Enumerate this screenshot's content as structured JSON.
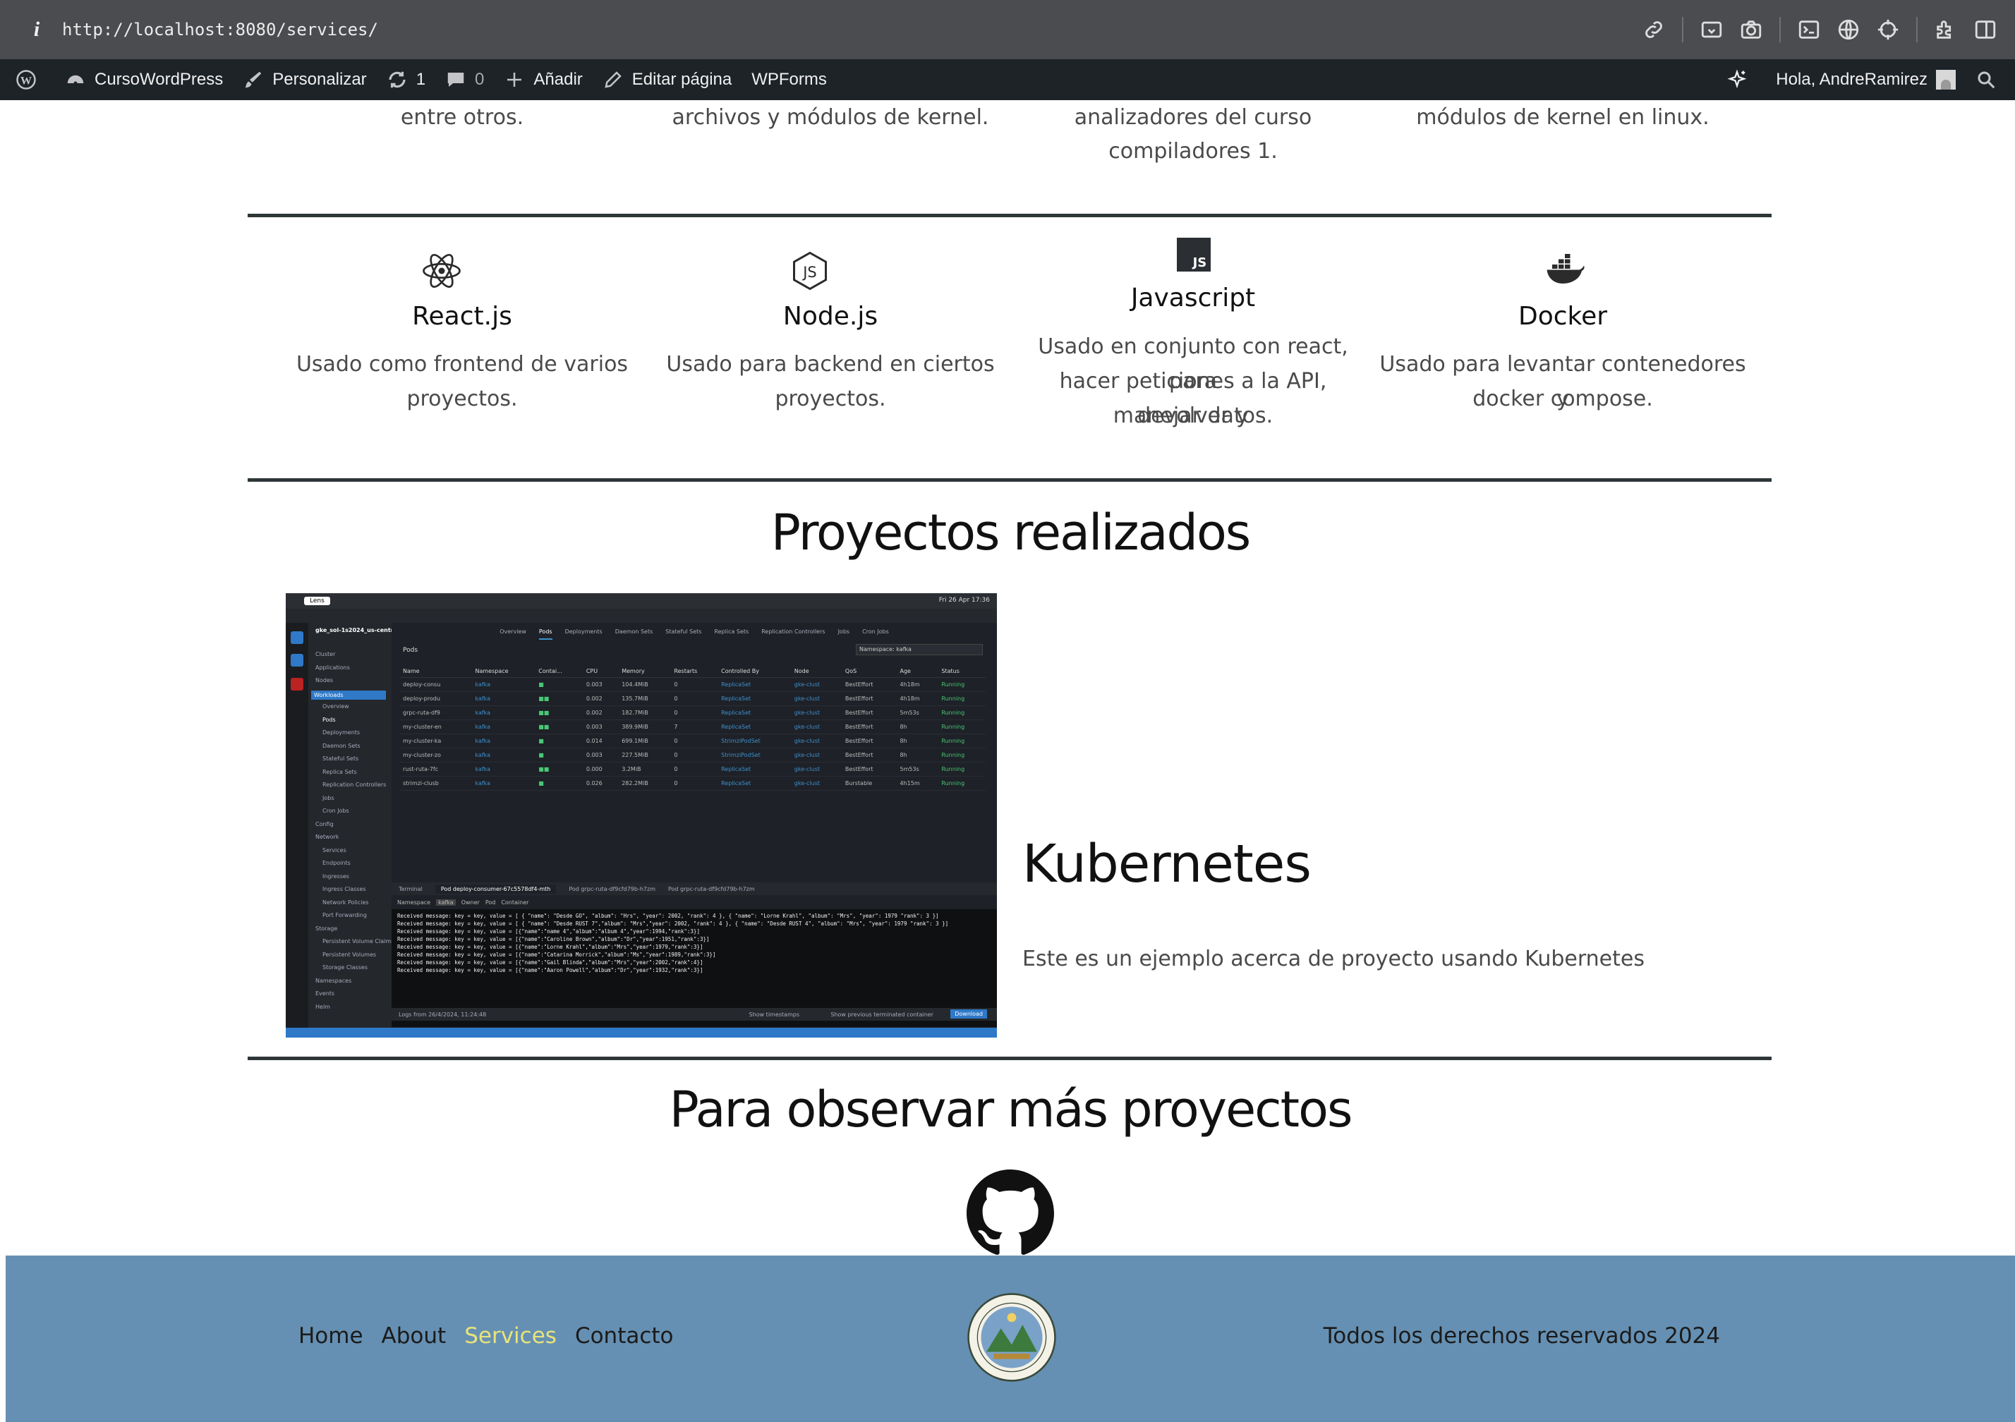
{
  "browser": {
    "url": "http://localhost:8080/services/",
    "info_glyph": "i"
  },
  "adminbar": {
    "site_name": "CursoWordPress",
    "customize": "Personalizar",
    "updates_count": "1",
    "comments_count": "0",
    "add_new": "Añadir",
    "edit_page": "Editar página",
    "wpforms": "WPForms",
    "greeting": "Hola, AndreRamirez"
  },
  "top_row": {
    "col1": "entre otros.",
    "col2": "archivos y módulos de kernel.",
    "col3_line1": "analizadores del curso",
    "col3_line2": "compiladores 1.",
    "col4": "módulos de kernel en linux."
  },
  "tech": [
    {
      "icon": "react-icon",
      "title": "React.js",
      "desc_line1": "Usado como frontend de varios",
      "desc_line2": "proyectos."
    },
    {
      "icon": "nodejs-icon",
      "title": "Node.js",
      "desc_line1": "Usado para backend en ciertos",
      "desc_line2": "proyectos."
    },
    {
      "icon": "javascript-icon",
      "title": "Javascript",
      "desc_line1": "Usado en conjunto con react, para",
      "desc_line2": "hacer peticiones a la API, devolver y",
      "desc_line3": "manejar datos."
    },
    {
      "icon": "docker-icon",
      "title": "Docker",
      "desc_line1": "Usado para levantar contenedores y",
      "desc_line2": "docker compose."
    }
  ],
  "projects": {
    "heading": "Proyectos realizados",
    "kubernetes_title": "Kubernetes",
    "kubernetes_desc": "Este es un ejemplo acerca de proyecto usando Kubernetes"
  },
  "screenshot": {
    "app_label": "Lens",
    "clock": "Fri 26 Apr 17:36",
    "cluster": "gke_sol-1s2024_us-central1-...",
    "tabs": [
      "Overview",
      "Pods",
      "Deployments",
      "Daemon Sets",
      "Stateful Sets",
      "Replica Sets",
      "Replication Controllers",
      "Jobs",
      "Cron Jobs"
    ],
    "pods_title": "Pods",
    "namespace_filter": "Namespace: kafka",
    "sidebar": [
      "Cluster",
      "Applications",
      "Nodes",
      "Workloads",
      "Overview",
      "Pods",
      "Deployments",
      "Daemon Sets",
      "Stateful Sets",
      "Replica Sets",
      "Replication Controllers",
      "Jobs",
      "Cron Jobs",
      "Config",
      "Network",
      "Services",
      "Endpoints",
      "Ingresses",
      "Ingress Classes",
      "Network Policies",
      "Port Forwarding",
      "Storage",
      "Persistent Volume Claims",
      "Persistent Volumes",
      "Storage Classes",
      "Namespaces",
      "Events",
      "Helm"
    ],
    "columns": [
      "Name",
      "Namespace",
      "Contai...",
      "CPU",
      "Memory",
      "Restarts",
      "Controlled By",
      "Node",
      "QoS",
      "Age",
      "Status"
    ],
    "rows": [
      [
        "deploy-consu",
        "kafka",
        "■",
        "0.003",
        "104.4MiB",
        "0",
        "ReplicaSet",
        "gke-clust",
        "BestEffort",
        "4h18m",
        "Running"
      ],
      [
        "deploy-produ",
        "kafka",
        "■■",
        "0.002",
        "135.7MiB",
        "0",
        "ReplicaSet",
        "gke-clust",
        "BestEffort",
        "4h18m",
        "Running"
      ],
      [
        "grpc-ruta-df9",
        "kafka",
        "■■",
        "0.002",
        "182.7MiB",
        "0",
        "ReplicaSet",
        "gke-clust",
        "BestEffort",
        "5m53s",
        "Running"
      ],
      [
        "my-cluster-en",
        "kafka",
        "■■",
        "0.003",
        "389.9MiB",
        "7",
        "ReplicaSet",
        "gke-clust",
        "BestEffort",
        "8h",
        "Running"
      ],
      [
        "my-cluster-ka",
        "kafka",
        "■",
        "0.014",
        "699.1MiB",
        "0",
        "StrimziPodSet",
        "gke-clust",
        "BestEffort",
        "8h",
        "Running"
      ],
      [
        "my-cluster-zo",
        "kafka",
        "■",
        "0.003",
        "227.5MiB",
        "0",
        "StrimziPodSet",
        "gke-clust",
        "BestEffort",
        "8h",
        "Running"
      ],
      [
        "rust-ruta-7fc",
        "kafka",
        "■■",
        "0.000",
        "3.2MiB",
        "0",
        "ReplicaSet",
        "gke-clust",
        "BestEffort",
        "5m53s",
        "Running"
      ],
      [
        "strimzi-clusb",
        "kafka",
        "■",
        "0.026",
        "282.2MiB",
        "0",
        "ReplicaSet",
        "gke-clust",
        "Burstable",
        "4h15m",
        "Running"
      ]
    ],
    "term_tabs": [
      "Terminal",
      "Pod deploy-consumer-67c5578df4-mth",
      "Pod grpc-ruta-df9cfd79b-h7zm",
      "Pod grpc-ruta-df9cfd79b-h7zm"
    ],
    "log_lines": [
      "Received message: key = key, value = [ { \"name\": \"Desde GO\", \"album\": \"Hrs\", \"year\": 2002, \"rank\": 4 }, { \"name\": \"Lorne Krahl\", \"album\": \"Mrs\", \"year\": 1979 \"rank\": 3 }]",
      "Received message: key = key, value = [ { \"name\": \"Desde RUST 7\",\"album\": \"Mrs\",\"year\": 2002, \"rank\": 4 }, { \"name\": \"Desde RUST 4\", \"album\": \"Mrs\", \"year\": 1979 \"rank\": 3 }]",
      "Received message: key = key, value = [{\"name\":\"name 4\",\"album\":\"album 4\",\"year\":1994,\"rank\":3}]",
      "Received message: key = key, value = [{\"name\":\"Caroline Brown\",\"album\":\"Dr\",\"year\":1951,\"rank\":3}]",
      "Received message: key = key, value = [{\"name\":\"Lorne Krahl\",\"album\":\"Mrs\",\"year\":1979,\"rank\":3}]",
      "Received message: key = key, value = [{\"name\":\"Catarina Morrick\",\"album\":\"Ms\",\"year\":1989,\"rank\":3}]",
      "Received message: key = key, value = [{\"name\":\"Gail Blinda\",\"album\":\"Mrs\",\"year\":2002,\"rank\":4}]",
      "Received message: key = key, value = [{\"name\":\"Aaron Powell\",\"album\":\"Dr\",\"year\":1932,\"rank\":3}]"
    ],
    "logs_from": "Logs from 26/4/2024, 11:24:48",
    "show_timestamps": "Show timestamps",
    "show_previous": "Show previous terminated container",
    "download": "Download"
  },
  "more": {
    "heading": "Para observar más proyectos"
  },
  "footer": {
    "nav": [
      "Home",
      "About",
      "Services",
      "Contacto"
    ],
    "current_index": 2,
    "rights": "Todos los derechos reservados 2024"
  },
  "colors": {
    "admin_bar": "#1d2327",
    "footer_bg": "#6590b3",
    "footer_active": "#e8e37a",
    "divider": "#2f3638"
  }
}
